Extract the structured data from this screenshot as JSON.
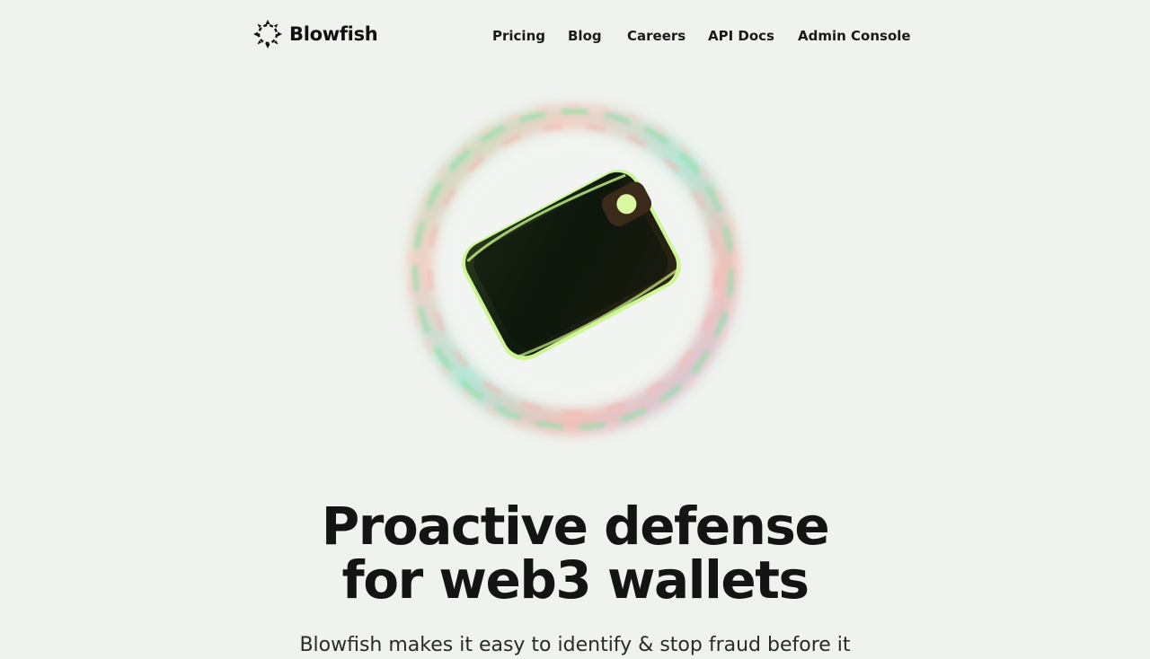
{
  "brand": {
    "name": "Blowfish",
    "logo_icon": "blowfish-spiky-circle-icon"
  },
  "nav": {
    "items": [
      {
        "label": "Pricing"
      },
      {
        "label": "Blog"
      },
      {
        "label": "Careers"
      },
      {
        "label": "API Docs"
      },
      {
        "label": "Admin Console"
      }
    ]
  },
  "hero": {
    "image": "wallet-in-iridescent-bubble",
    "headline_line1": "Proactive defense",
    "headline_line2": "for web3 wallets",
    "subtext": "Blowfish makes it easy to identify & stop fraud before it"
  },
  "colors": {
    "background": "#f0f2ef",
    "text": "#141414",
    "accent_green": "#c8f58a"
  }
}
